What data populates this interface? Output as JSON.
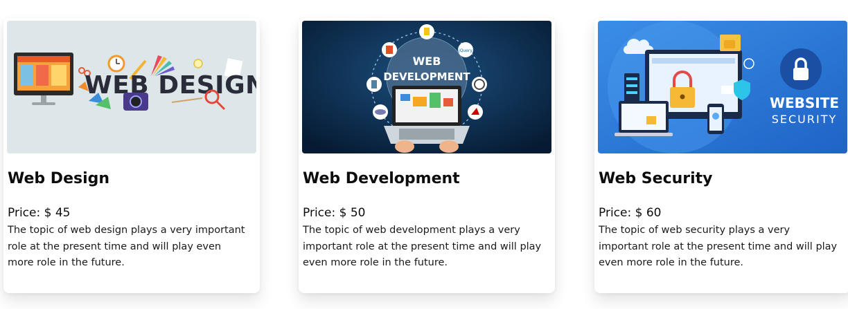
{
  "cards": [
    {
      "title": "Web Design",
      "price_label": "Price: $ 45",
      "description": "The topic of web design plays a very important role at the present time and will play even more role in the future.",
      "image": {
        "banner_text": "WEB DESIGN",
        "background": "#dde6e8",
        "icon": "web-design-illustration"
      }
    },
    {
      "title": "Web Development",
      "price_label": "Price: $ 50",
      "description": "The topic of web development plays a very important role at the present time and will play even more role in the future.",
      "image": {
        "banner_line1": "WEB",
        "banner_line2": "DEVELOPMENT",
        "background": "#0a2a4a",
        "icon": "web-development-illustration"
      }
    },
    {
      "title": "Web Security",
      "price_label": "Price: $ 60",
      "description": "The topic of web security plays a very important role at the present time and will play even more role in the future.",
      "image": {
        "banner_line1": "WEBSITE",
        "banner_line2": "SECURITY",
        "background": "#2f7fd9",
        "icon": "web-security-illustration"
      }
    }
  ]
}
